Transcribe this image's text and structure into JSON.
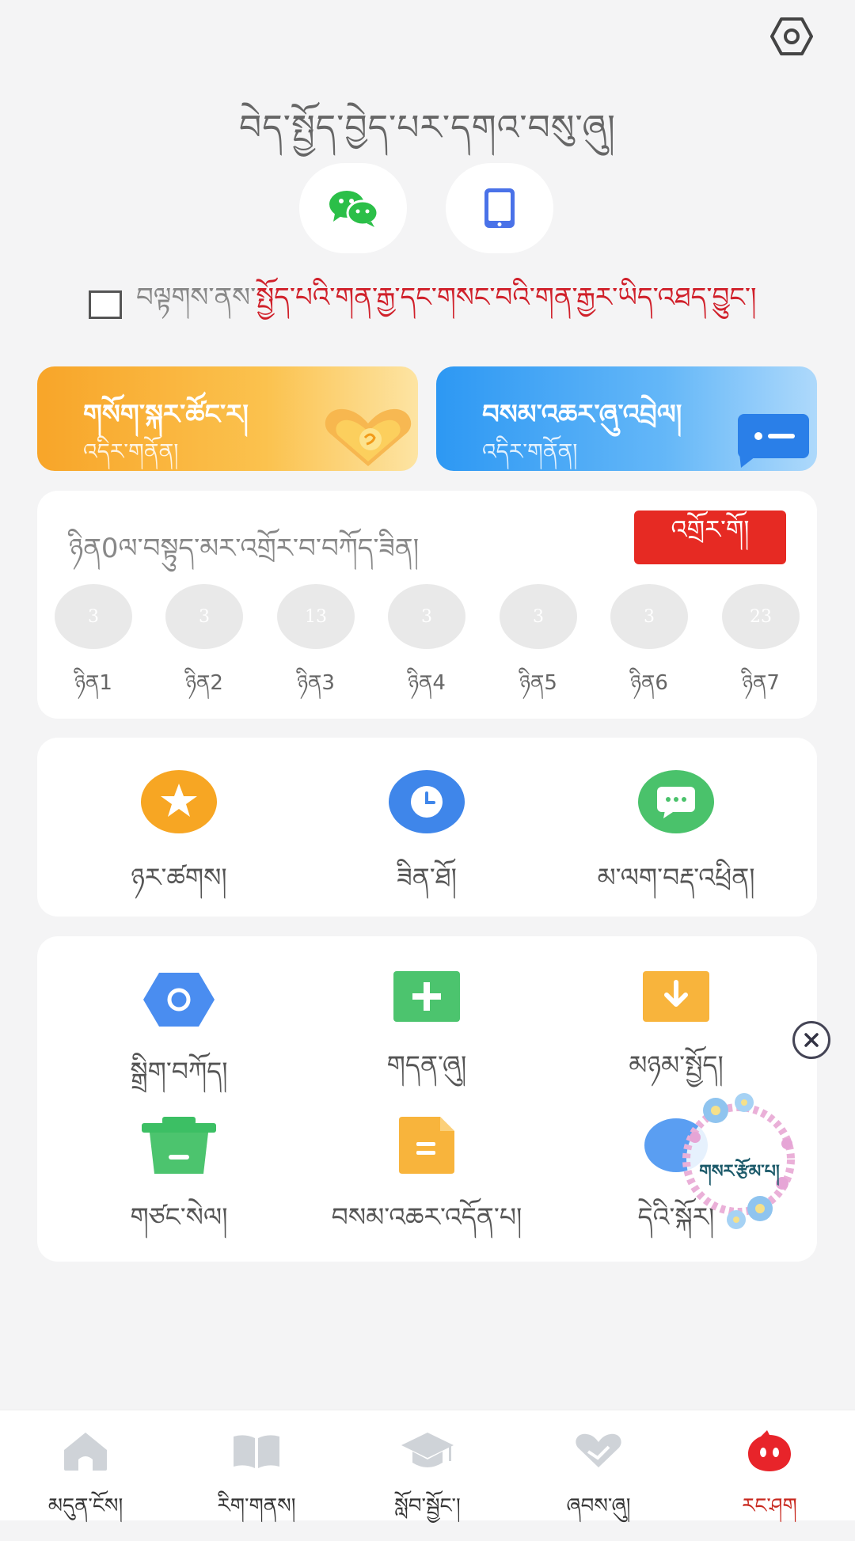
{
  "header": {
    "settings_icon": "hexagon-settings-icon"
  },
  "login": {
    "title": "བེད་སྤྱོད་བྱེད་པར་དགའ་བསུ་ཞུ།",
    "wechat_icon": "wechat-icon",
    "phone_icon": "phone-icon"
  },
  "agreement": {
    "prefix": "བལྟགས་ནས་",
    "link": "སྤྱོད་པའི་གན་རྒྱ་དང་གསང་བའི་གན་རྒྱར་ཡིད་འཐད་བྱུང་།"
  },
  "banners": [
    {
      "title": "གསོག་སྐར་ཚོང་ར།",
      "sub": "འདིར་གནོན།",
      "color": "#f8a529"
    },
    {
      "title": "བསམ་འཆར་ཞུ་འབྲེལ།",
      "sub": "འདིར་གནོན།",
      "color": "#2d98f3"
    }
  ],
  "checkin": {
    "text": "ཉིན0ལ་བསྟུད་མར་འགྲོར་བ་བཀོད་ཟིན།",
    "button": "འགྲོར་གོ།",
    "days": [
      {
        "value": "3",
        "label": "ཉིན1"
      },
      {
        "value": "3",
        "label": "ཉིན2"
      },
      {
        "value": "13",
        "label": "ཉིན3"
      },
      {
        "value": "3",
        "label": "ཉིན4"
      },
      {
        "value": "3",
        "label": "ཉིན5"
      },
      {
        "value": "3",
        "label": "ཉིན6"
      },
      {
        "value": "23",
        "label": "ཉིན7"
      }
    ]
  },
  "quick": [
    {
      "label": "ཉར་ཚགས།",
      "icon": "star-icon"
    },
    {
      "label": "ཟིན་ཐོ།",
      "icon": "clock-icon"
    },
    {
      "label": "མ་ལག་བརྡ་འཕྲིན།",
      "icon": "message-icon"
    }
  ],
  "tools": [
    {
      "label": "སྒྲིག་བཀོད།",
      "icon": "settings-icon"
    },
    {
      "label": "གདན་ཞུ།",
      "icon": "plus-icon"
    },
    {
      "label": "མཉམ་སྤྱོད།",
      "icon": "download-icon"
    },
    {
      "label": "གཙང་སེལ།",
      "icon": "trash-icon"
    },
    {
      "label": "བསམ་འཆར་འདོན་པ།",
      "icon": "document-icon"
    },
    {
      "label": "དེའི་སྐོར།",
      "icon": "info-icon"
    }
  ],
  "floating": {
    "text": "གསར་རྩོམ་པ།",
    "close_icon": "close-icon"
  },
  "tabbar": [
    {
      "label": "མདུན་ངོས།",
      "icon": "home-icon",
      "active": false
    },
    {
      "label": "རིག་གནས།",
      "icon": "book-icon",
      "active": false
    },
    {
      "label": "སློབ་སྦྱོང་།",
      "icon": "graduation-cap-icon",
      "active": false
    },
    {
      "label": "ཞབས་ཞུ།",
      "icon": "heart-hands-icon",
      "active": false
    },
    {
      "label": "རང་ཤག",
      "icon": "profile-face-icon",
      "active": true
    }
  ],
  "colors": {
    "accent": "#e62a23",
    "active_tab": "#c8281e",
    "background": "#f4f4f5"
  }
}
